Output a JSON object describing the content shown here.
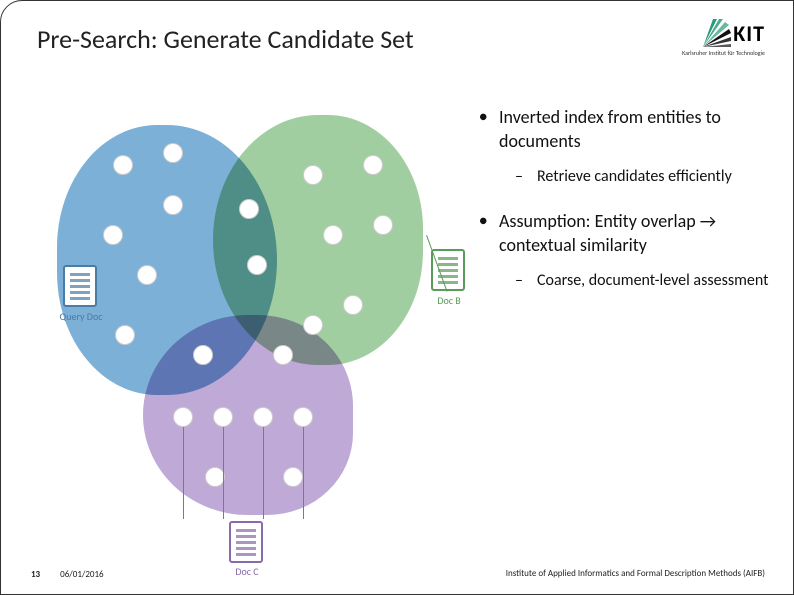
{
  "title": "Pre-Search: Generate Candidate Set",
  "logo": {
    "text": "KIT",
    "subtitle": "Karlsruher Institut für Technologie"
  },
  "bullets": [
    {
      "text": "Inverted index from entities to documents",
      "sub": "Retrieve candidates efficiently"
    },
    {
      "text": "Assumption: Entity overlap → contextual similarity",
      "sub": "Coarse, document-level assessment"
    }
  ],
  "diagram": {
    "docs": {
      "query": "Query Doc",
      "b": "Doc B",
      "c": "Doc C"
    }
  },
  "footer": {
    "page": "13",
    "date": "06/01/2016",
    "institute": "Institute of Applied Informatics and Formal Description Methods (AIFB)"
  }
}
